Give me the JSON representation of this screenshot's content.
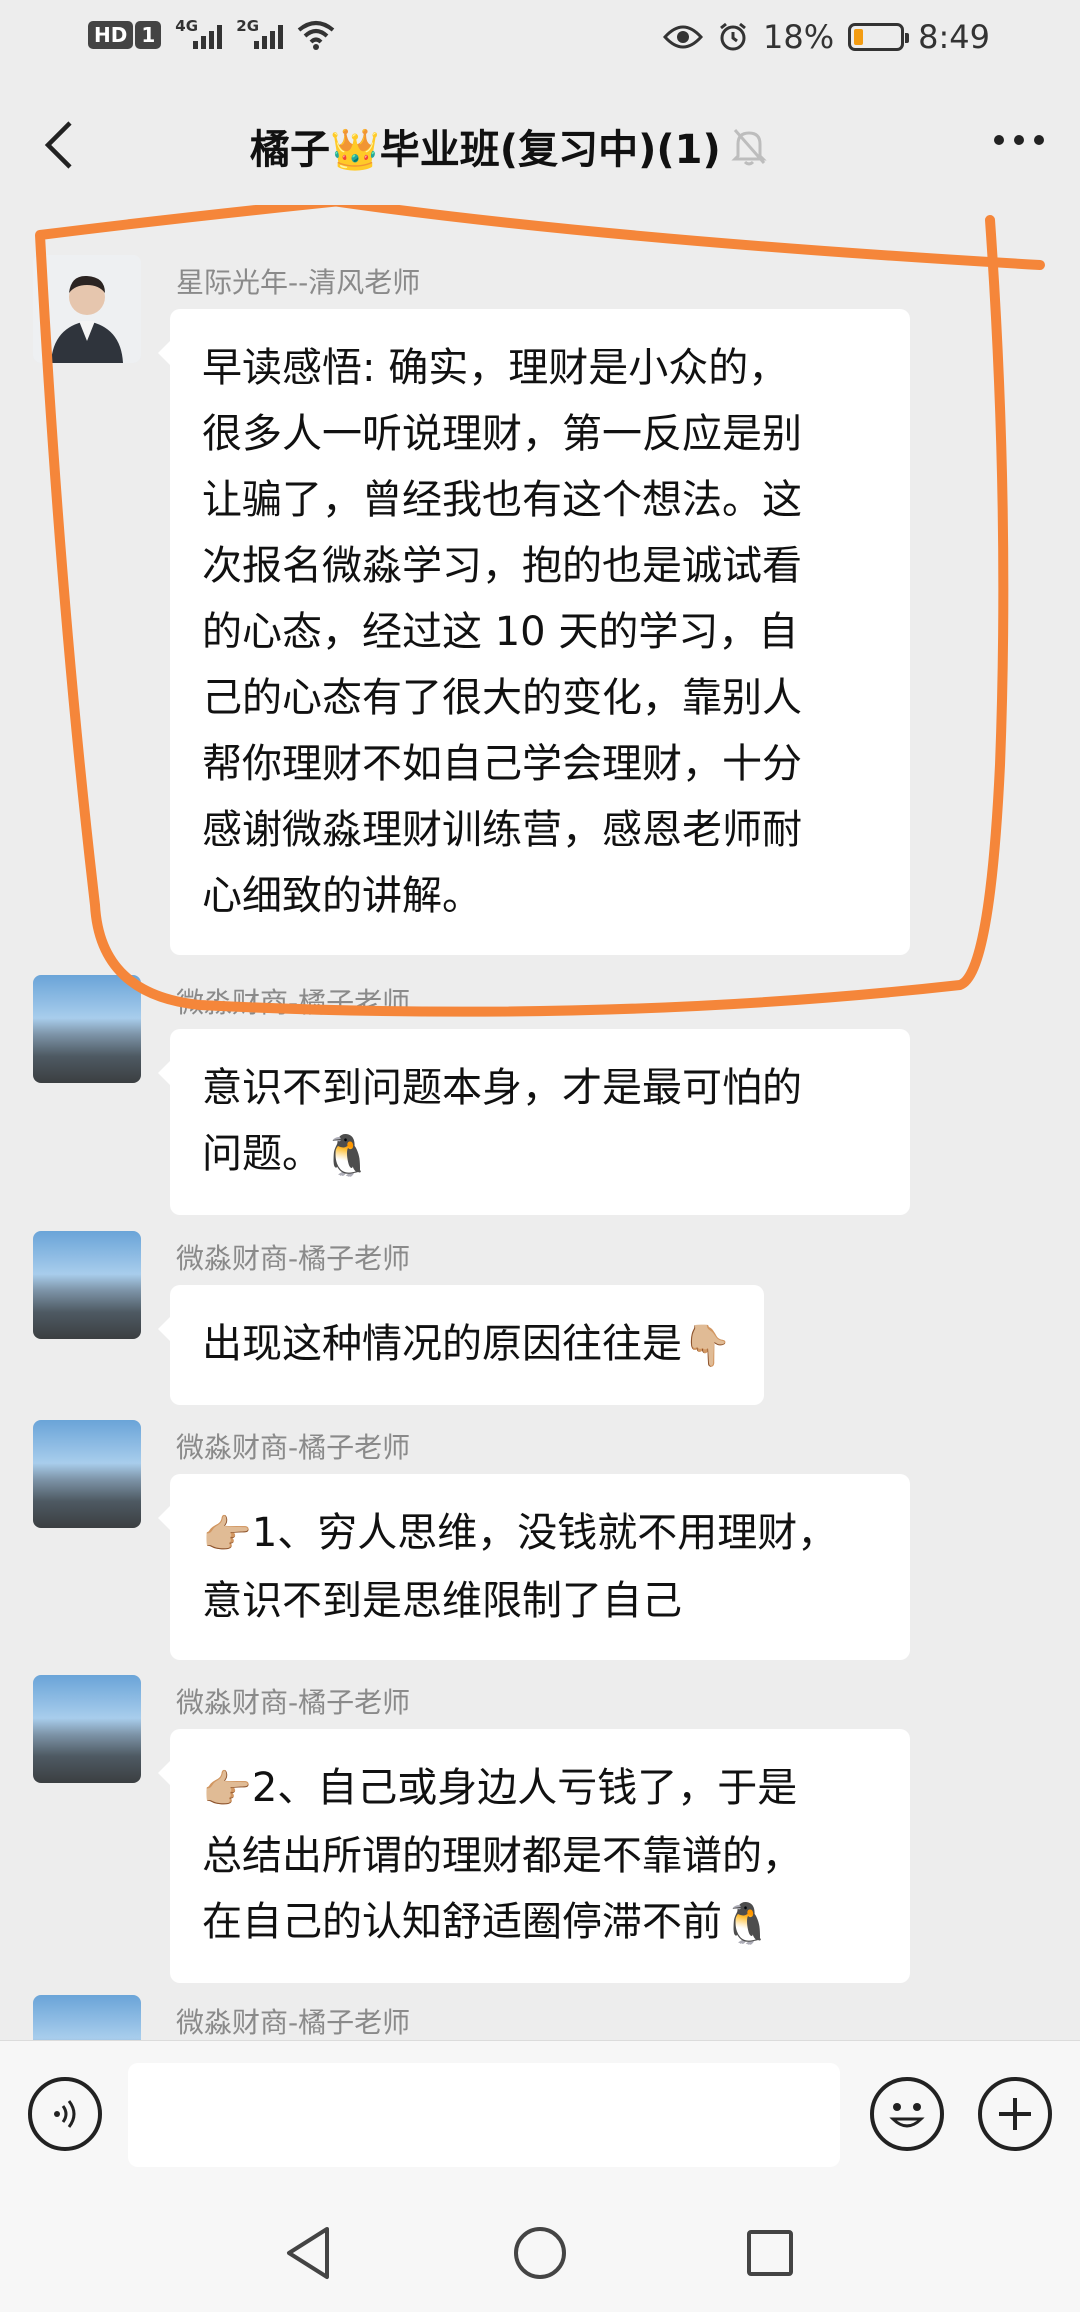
{
  "status_bar": {
    "hd_badge": "HD",
    "sim1": "1",
    "net1": "4G",
    "net2": "2G",
    "battery_percent_text": "18%",
    "battery_level": 0.18,
    "time": "8:49"
  },
  "header": {
    "title": "橘子👑毕业班(复习中)(1)",
    "icons": {
      "back": "chevron-left-icon",
      "mute": "bell-off-icon",
      "more": "more-dots-icon"
    }
  },
  "messages": [
    {
      "sender": "星际光年--清风老师",
      "avatar": "teacher-avatar",
      "lines": [
        "早读感悟: 确实，理财是小众的，",
        "很多人一听说理财，第一反应是别",
        "让骗了，曾经我也有这个想法。这",
        "次报名微淼学习，抱的也是诚试看",
        "的心态，经过这 10 天的学习，自",
        "己的心态有了很大的变化，靠别人",
        "帮你理财不如自己学会理财，十分",
        "感谢微淼理财训练营，感恩老师耐",
        "心细致的讲解。"
      ]
    },
    {
      "sender": "微淼财商-橘子老师",
      "avatar": "landscape-avatar",
      "lines": [
        "意识不到问题本身，才是最可怕的",
        "问题。"
      ],
      "trailing_emoji": "🐧"
    },
    {
      "sender": "微淼财商-橘子老师",
      "avatar": "landscape-avatar",
      "lines": [
        "出现这种情况的原因往往是"
      ],
      "trailing_emoji": "👇🏼"
    },
    {
      "sender": "微淼财商-橘子老师",
      "avatar": "landscape-avatar",
      "leading_emoji": "👉🏼",
      "lines": [
        "1、穷人思维，没钱就不用理财，",
        "意识不到是思维限制了自己"
      ]
    },
    {
      "sender": "微淼财商-橘子老师",
      "avatar": "landscape-avatar",
      "leading_emoji": "👉🏼",
      "lines": [
        "2、自己或身边人亏钱了，于是",
        "总结出所谓的理财都是不靠谱的，",
        "在自己的认知舒适圈停滞不前"
      ],
      "trailing_emoji": "🐧"
    },
    {
      "sender": "微淼财商-橘子老师",
      "avatar": "landscape-avatar"
    }
  ],
  "input_bar": {
    "placeholder": "",
    "icons": {
      "voice": "voice-icon",
      "emoji": "emoji-icon",
      "plus": "plus-icon"
    }
  },
  "nav_bar": {
    "icons": {
      "back": "nav-back-icon",
      "home": "nav-home-icon",
      "recents": "nav-recents-icon"
    }
  },
  "colors": {
    "background": "#ededed",
    "bubble": "#ffffff",
    "highlight_stroke": "#f5863a",
    "sender_text": "#8a8a8a"
  }
}
